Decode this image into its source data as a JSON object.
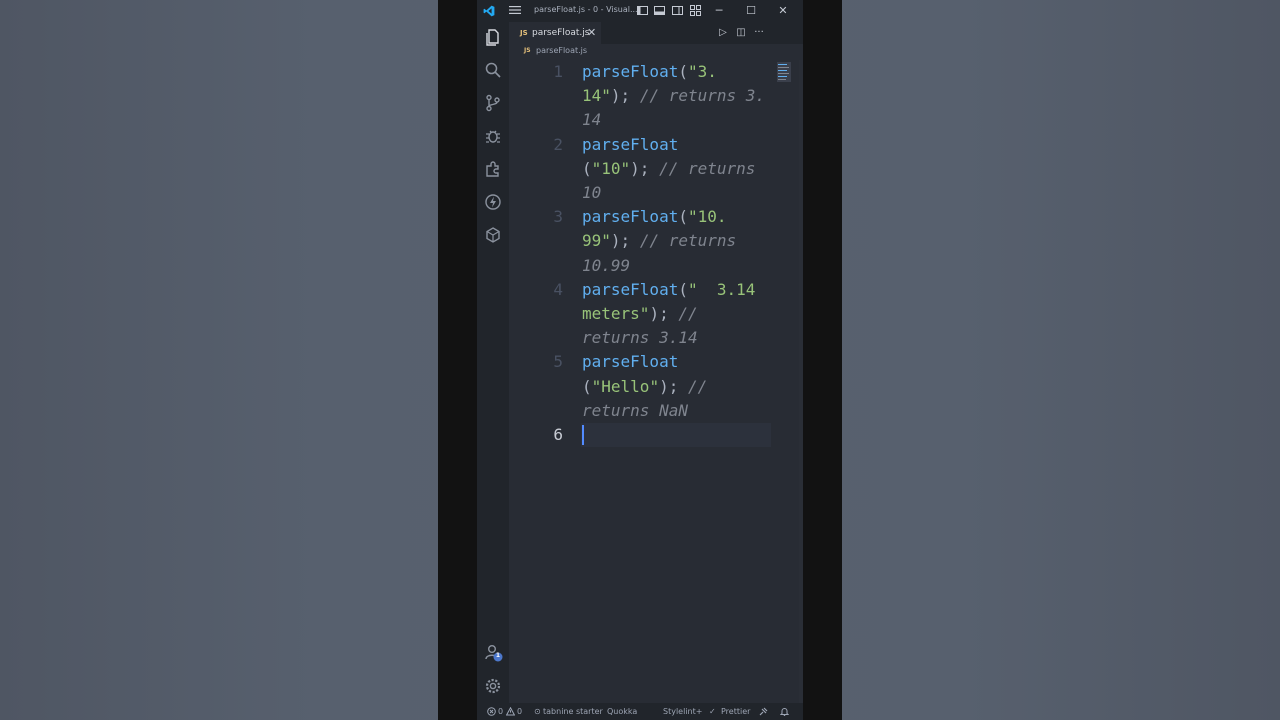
{
  "window": {
    "title": "parseFloat.js - 0 - Visual...",
    "controls": {
      "minimize": "─",
      "maximize": "☐",
      "close": "✕"
    }
  },
  "activity_bar": {
    "top": [
      "files-icon",
      "search-icon",
      "source-control-icon",
      "run-debug-icon",
      "extensions-icon",
      "quokka-icon",
      "remote-icon"
    ],
    "bottom": [
      "accounts-icon",
      "settings-icon"
    ],
    "accounts_badge": "1"
  },
  "tabs": [
    {
      "icon": "JS",
      "label": "parseFloat.js",
      "close": "✕",
      "active": true
    }
  ],
  "tab_actions": {
    "run": "▷",
    "split": "◫",
    "more": "···"
  },
  "breadcrumb": {
    "icon": "JS",
    "label": "parseFloat.js"
  },
  "editor": {
    "lines": [
      {
        "number": "1",
        "segments": [
          [
            {
              "t": "parseFloat",
              "c": "fn"
            },
            {
              "t": "(",
              "c": "pn"
            },
            {
              "t": "\"3.",
              "c": "str"
            }
          ],
          [
            {
              "t": "14\"",
              "c": "str"
            },
            {
              "t": "); ",
              "c": "pn"
            },
            {
              "t": "// returns 3.",
              "c": "cm"
            }
          ],
          [
            {
              "t": "14",
              "c": "cm"
            }
          ]
        ]
      },
      {
        "number": "2",
        "segments": [
          [
            {
              "t": "parseFloat",
              "c": "fn"
            }
          ],
          [
            {
              "t": "(",
              "c": "pn"
            },
            {
              "t": "\"10\"",
              "c": "str"
            },
            {
              "t": "); ",
              "c": "pn"
            },
            {
              "t": "// returns",
              "c": "cm"
            }
          ],
          [
            {
              "t": "10",
              "c": "cm"
            }
          ]
        ]
      },
      {
        "number": "3",
        "segments": [
          [
            {
              "t": "parseFloat",
              "c": "fn"
            },
            {
              "t": "(",
              "c": "pn"
            },
            {
              "t": "\"10.",
              "c": "str"
            }
          ],
          [
            {
              "t": "99\"",
              "c": "str"
            },
            {
              "t": "); ",
              "c": "pn"
            },
            {
              "t": "// returns",
              "c": "cm"
            }
          ],
          [
            {
              "t": "10.99",
              "c": "cm"
            }
          ]
        ]
      },
      {
        "number": "4",
        "segments": [
          [
            {
              "t": "parseFloat",
              "c": "fn"
            },
            {
              "t": "(",
              "c": "pn"
            },
            {
              "t": "\"  3.14",
              "c": "str"
            }
          ],
          [
            {
              "t": "meters\"",
              "c": "str"
            },
            {
              "t": "); ",
              "c": "pn"
            },
            {
              "t": "//",
              "c": "cm"
            }
          ],
          [
            {
              "t": "returns 3.14",
              "c": "cm"
            }
          ]
        ]
      },
      {
        "number": "5",
        "segments": [
          [
            {
              "t": "parseFloat",
              "c": "fn"
            }
          ],
          [
            {
              "t": "(",
              "c": "pn"
            },
            {
              "t": "\"Hello\"",
              "c": "str"
            },
            {
              "t": "); ",
              "c": "pn"
            },
            {
              "t": "//",
              "c": "cm"
            }
          ],
          [
            {
              "t": "returns NaN",
              "c": "cm"
            }
          ]
        ]
      },
      {
        "number": "6",
        "segments": [
          [
            {
              "t": "",
              "c": "pn"
            }
          ]
        ]
      }
    ],
    "active_line": "6"
  },
  "status_bar": {
    "errors": "0",
    "warnings": "0",
    "tabnine": "tabnine starter",
    "quokka": "Quokka",
    "stylelint": "Stylelint+",
    "prettier": "Prettier"
  },
  "colors": {
    "function": "#61afef",
    "string": "#98c379",
    "comment": "#7f848e",
    "cursor": "#528bff",
    "editor_bg": "#282c34",
    "chrome_bg": "#21252b",
    "vscode_blue": "#23a9f2"
  }
}
